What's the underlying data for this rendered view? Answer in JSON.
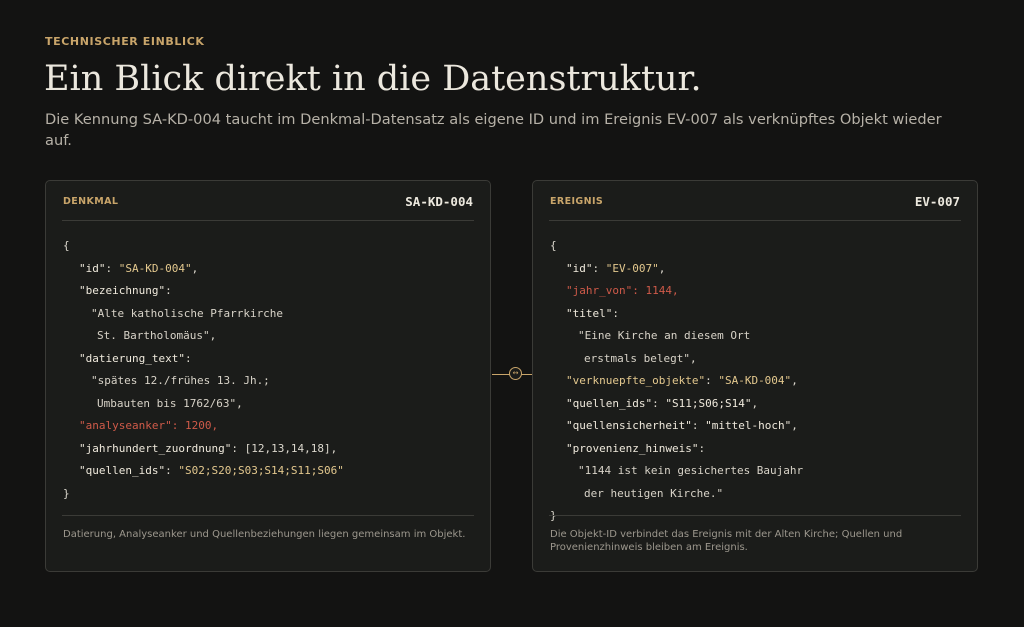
{
  "header": {
    "eyebrow": "TECHNISCHER EINBLICK",
    "title": "Ein Blick direkt in die Datenstruktur.",
    "subtitle": "Die Kennung SA-KD-004 taucht im Denkmal-Datensatz als eigene ID und im Ereignis EV-007 als verknüpftes Objekt wieder auf."
  },
  "connector": {
    "icon": "link-icon",
    "glyph": "↔"
  },
  "left_panel": {
    "label": "DENKMAL",
    "id": "SA-KD-004",
    "footer": "Datierung, Analyseanker und Quellenbeziehungen liegen gemeinsam im Objekt.",
    "code": {
      "open": "{",
      "close": "}",
      "id_key": "\"id\"",
      "id_val": "\"SA-KD-004\"",
      "bez_key": "\"bezeichnung\"",
      "bez_val1": "\"Alte katholische Pfarrkirche",
      "bez_val2": "St. Bartholomäus\"",
      "dat_key": "\"datierung_text\"",
      "dat_val1": "\"spätes 12./frühes 13. Jh.;",
      "dat_val2": "Umbauten bis 1762/63\"",
      "anker": "\"analyseanker\": 1200,",
      "jh_key": "\"jahrhundert_zuordnung\"",
      "jh_val": "[12,13,14,18]",
      "q_key": "\"quellen_ids\"",
      "q_val": "\"S02;S20;S03;S14;S11;S06\""
    }
  },
  "right_panel": {
    "label": "EREIGNIS",
    "id": "EV-007",
    "footer": "Die Objekt-ID verbindet das Ereignis mit der Alten Kirche; Quellen und Provenienzhinweis bleiben am Ereignis.",
    "code": {
      "open": "{",
      "close": "}",
      "id_key": "\"id\"",
      "id_val": "\"EV-007\"",
      "jahr": "\"jahr_von\": 1144,",
      "titel_key": "\"titel\"",
      "titel_val1": "\"Eine Kirche an diesem Ort",
      "titel_val2": "erstmals belegt\"",
      "vk_key": "\"verknuepfte_objekte\"",
      "vk_val": "\"SA-KD-004\"",
      "q_key": "\"quellen_ids\"",
      "q_val": "\"S11;S06;S14\"",
      "qs_key": "\"quellensicherheit\"",
      "qs_val": "\"mittel-hoch\"",
      "ph_key": "\"provenienz_hinweis\"",
      "ph_val1": "\"1144 ist kein gesichertes Baujahr",
      "ph_val2": "der heutigen Kirche.\""
    }
  }
}
